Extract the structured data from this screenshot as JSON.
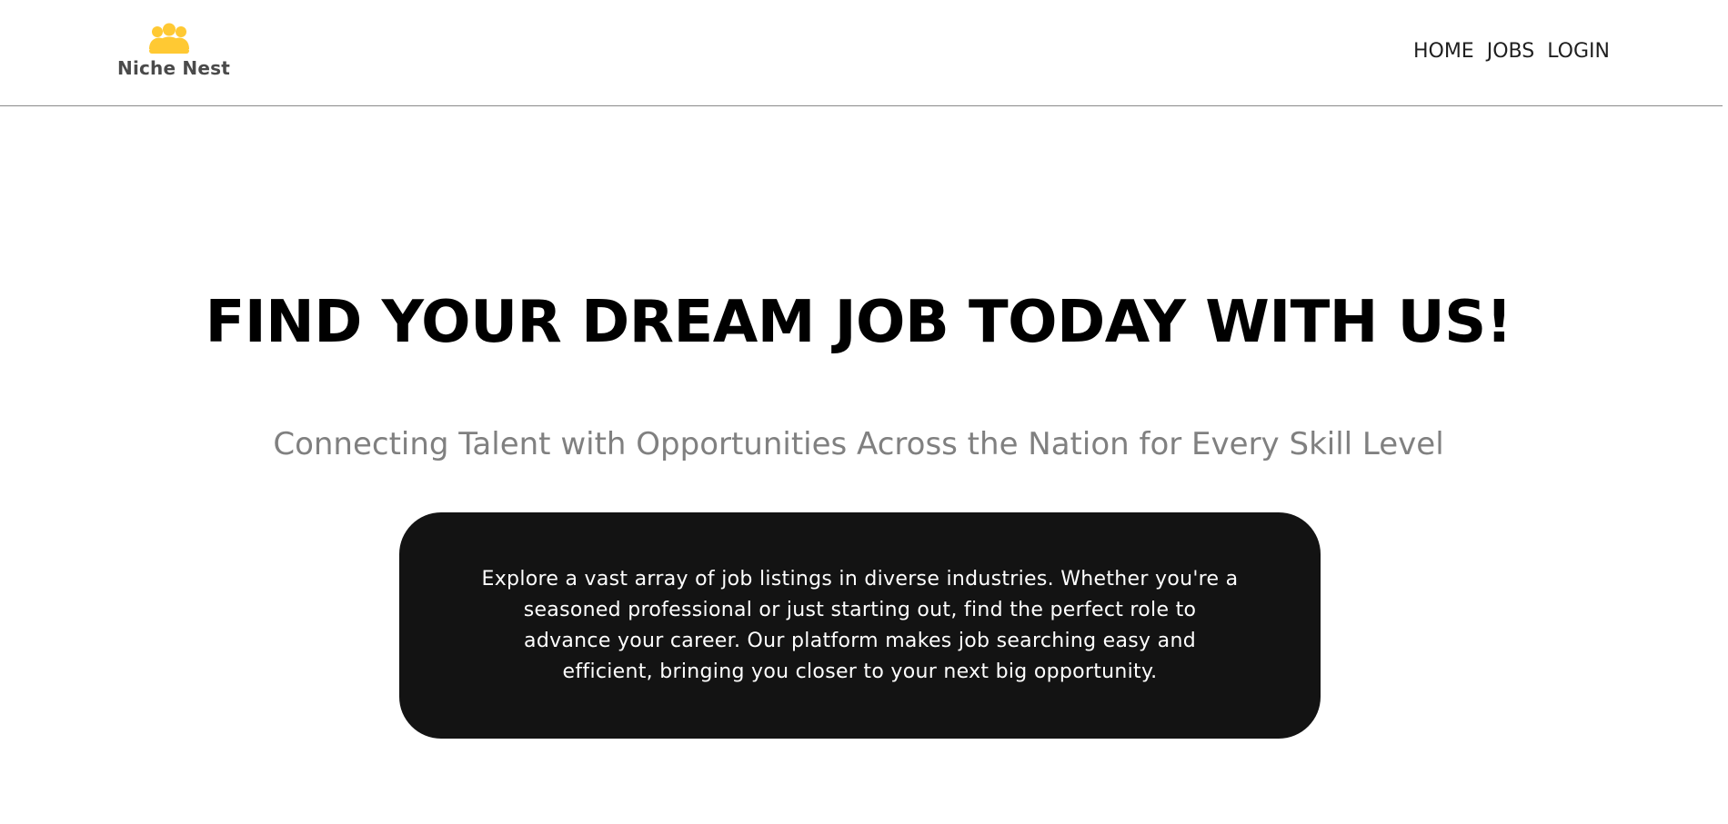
{
  "brand": {
    "name": "Niche Nest",
    "logo_icon": "people-group-icon",
    "accent_color": "#FFC933"
  },
  "nav": {
    "links": [
      {
        "label": "HOME"
      },
      {
        "label": "JOBS"
      },
      {
        "label": "LOGIN"
      }
    ]
  },
  "hero": {
    "title": "FIND YOUR DREAM JOB TODAY WITH US!",
    "subtitle": "Connecting Talent with Opportunities Across the Nation for Every Skill Level"
  },
  "info_card": {
    "text": "Explore a vast array of job listings in diverse industries. Whether you're a seasoned professional or just starting out, find the perfect role to advance your career. Our platform makes job searching easy and efficient, bringing you closer to your next big opportunity.",
    "background_color": "#131313"
  }
}
